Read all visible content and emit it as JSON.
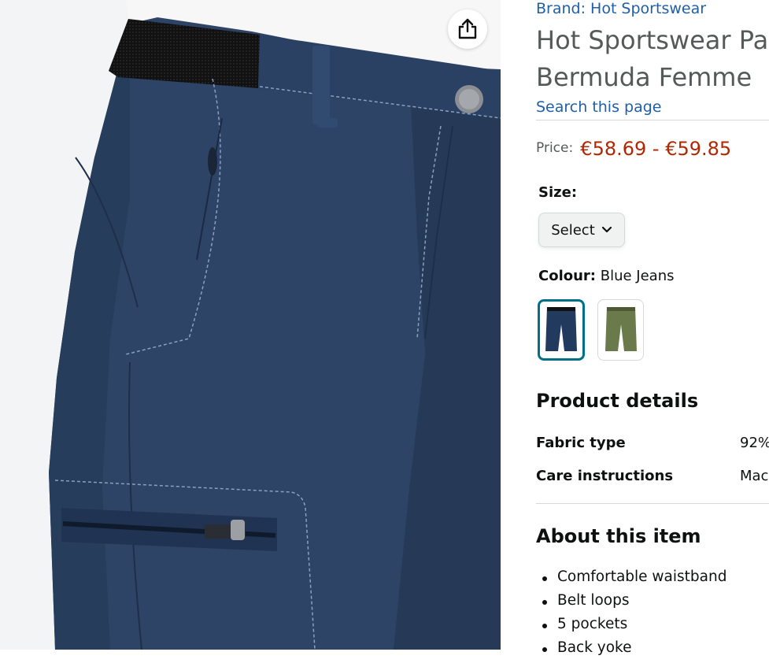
{
  "product": {
    "brand": "Brand: Hot Sportswear",
    "title_line1": "Hot Sportswear Pa",
    "title_line2": "Bermuda Femme",
    "search_link": "Search this page"
  },
  "price": {
    "label": "Price:",
    "value": "€58.69 - €59.85"
  },
  "size": {
    "label": "Size:",
    "select_label": "Select"
  },
  "colour": {
    "label": "Colour:",
    "selected": "Blue Jeans",
    "options": [
      "blue-jeans",
      "olive-green"
    ],
    "swatch_colors": {
      "blue": "#223a5e",
      "olive": "#6b7a4a"
    }
  },
  "details": {
    "heading": "Product details",
    "rows": [
      {
        "key": "Fabric type",
        "value": "92%"
      },
      {
        "key": "Care instructions",
        "value": "Mac"
      }
    ]
  },
  "about": {
    "heading": "About this item",
    "bullets": [
      "Comfortable waistband",
      "Belt loops",
      "5 pockets",
      "Back yoke"
    ]
  },
  "colors": {
    "link": "#1f5fa8",
    "price": "#b12704",
    "selected_border": "#007185",
    "pants": "#2d4466"
  }
}
